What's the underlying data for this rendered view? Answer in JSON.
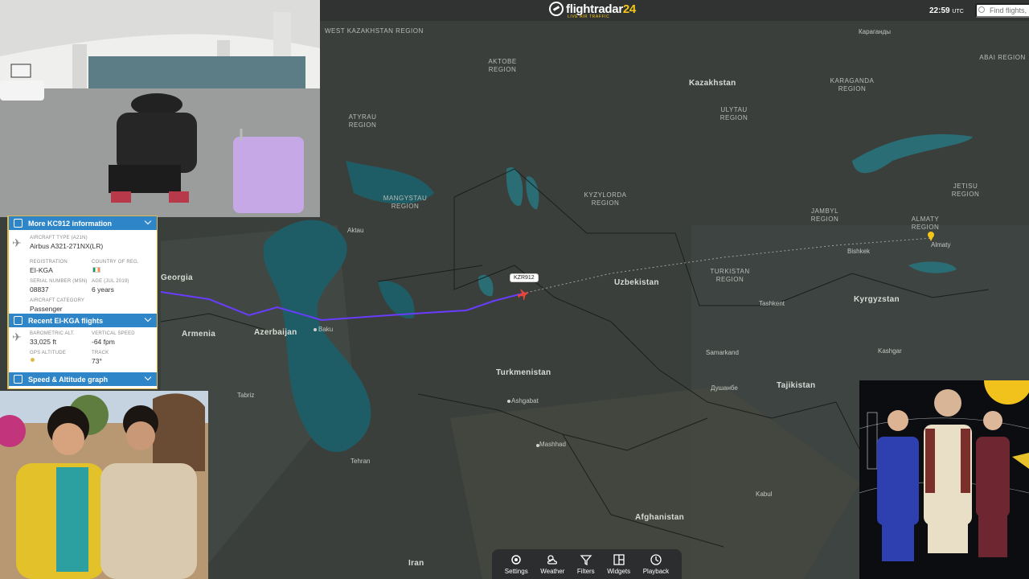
{
  "topbar": {
    "logo": "flightradar24",
    "logo_tagline": "LIVE AIR TRAFFIC",
    "time": "22:59",
    "time_zone": "UTC",
    "search_placeholder": "Find flights,"
  },
  "map": {
    "flight_label": "KZR912",
    "countries": {
      "kazakhstan": "Kazakhstan",
      "uzbekistan": "Uzbekistan",
      "turkmenistan": "Turkmenistan",
      "kyrgyzstan": "Kyrgyzstan",
      "tajikistan": "Tajikistan",
      "afghanistan": "Afghanistan",
      "azerbaijan": "Azerbaijan",
      "armenia": "Armenia",
      "georgia": "Georgia",
      "iran": "Iran"
    },
    "regions": {
      "west_kazakhstan": "WEST KAZAKHSTAN REGION",
      "aktobe": "AKTOBE REGION",
      "karaganda": "KARAGANDA REGION",
      "abai": "ABAI REGION",
      "ulytau": "ULYTAU REGION",
      "atyrau": "ATYRAU REGION",
      "mangystau": "MANGYSTAU REGION",
      "kyzylorda": "KYZYLORDA REGION",
      "jambyl": "JAMBYL REGION",
      "jetisu": "JETISU REGION",
      "almaty": "ALMATY REGION",
      "turkistan": "TURKISTAN REGION"
    },
    "cities": {
      "baku": "Baku",
      "ashgabat": "Ashgabat",
      "mashhad": "Mashhad",
      "tashkent": "Tashkent",
      "bishkek": "Bishkek",
      "almaty": "Almaty",
      "dushanbe": "Душанбе",
      "karaganda_city": "Караганды",
      "tehran": "Tehran",
      "tabriz": "Tabriz",
      "kabul": "Kabul",
      "samarkand": "Samarkand",
      "aktau": "Aktau",
      "kashgar": "Kashgar"
    }
  },
  "panel": {
    "info_header": "More KC912 information",
    "aircraft_type_label": "AIRCRAFT TYPE (A21N)",
    "aircraft_type_value": "Airbus A321-271NX(LR)",
    "registration_label": "REGISTRATION",
    "registration_value": "EI-KGA",
    "country_label": "COUNTRY OF REG.",
    "serial_label": "SERIAL NUMBER (MSN)",
    "serial_value": "08837",
    "age_label": "AGE (Jul 2019)",
    "age_value": "6 years",
    "category_label": "AIRCRAFT CATEGORY",
    "category_value": "Passenger",
    "recent_header": "Recent EI-KGA flights",
    "baro_label": "BAROMETRIC ALT.",
    "baro_value": "33,025 ft",
    "vspeed_label": "VERTICAL SPEED",
    "vspeed_value": "-64 fpm",
    "gps_label": "GPS ALTITUDE",
    "track_label": "TRACK",
    "track_value": "73°",
    "graph_header": "Speed & Altitude graph"
  },
  "toolbar": {
    "items": [
      "Settings",
      "Weather",
      "Filters",
      "Widgets",
      "Playback"
    ]
  },
  "colors": {
    "flight_path": "#6a3cff",
    "panel_header": "#2e86c9",
    "panel_border": "#e1b94a",
    "aircraft": "#e8443a",
    "accent": "#f5c518"
  }
}
